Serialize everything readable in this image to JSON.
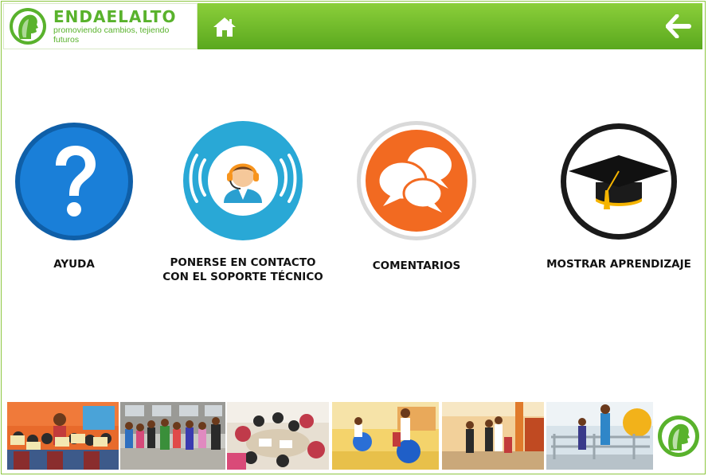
{
  "header": {
    "brand_name": "ENDAELALTO",
    "brand_tagline": "promoviendo cambios, tejiendo futuros",
    "home_icon": "home-icon",
    "back_icon": "arrow-left-icon",
    "colors": {
      "bar_top": "#8bcf3a",
      "bar_bottom": "#5aa81e",
      "brand_green": "#59b22c"
    }
  },
  "actions": [
    {
      "label": "AYUDA",
      "icon": "question-mark-icon",
      "color": "#1a73c6"
    },
    {
      "label": "PONERSE EN CONTACTO\nCON EL SOPORTE TÉCNICO",
      "icon": "support-agent-icon",
      "color": "#29a8d6"
    },
    {
      "label": "COMENTARIOS",
      "icon": "chat-bubbles-icon",
      "color": "#f26a21"
    },
    {
      "label": "MOSTRAR APRENDIZAJE",
      "icon": "graduation-cap-icon",
      "color": "#111111"
    }
  ],
  "photo_strip": {
    "photos": [
      "group-children-photo",
      "children-dancing-photo",
      "children-drawing-photo",
      "therapy-balls-photo",
      "hallway-visit-photo",
      "physiotherapy-room-photo"
    ],
    "logo_icon": "face-profile-logo-icon"
  }
}
